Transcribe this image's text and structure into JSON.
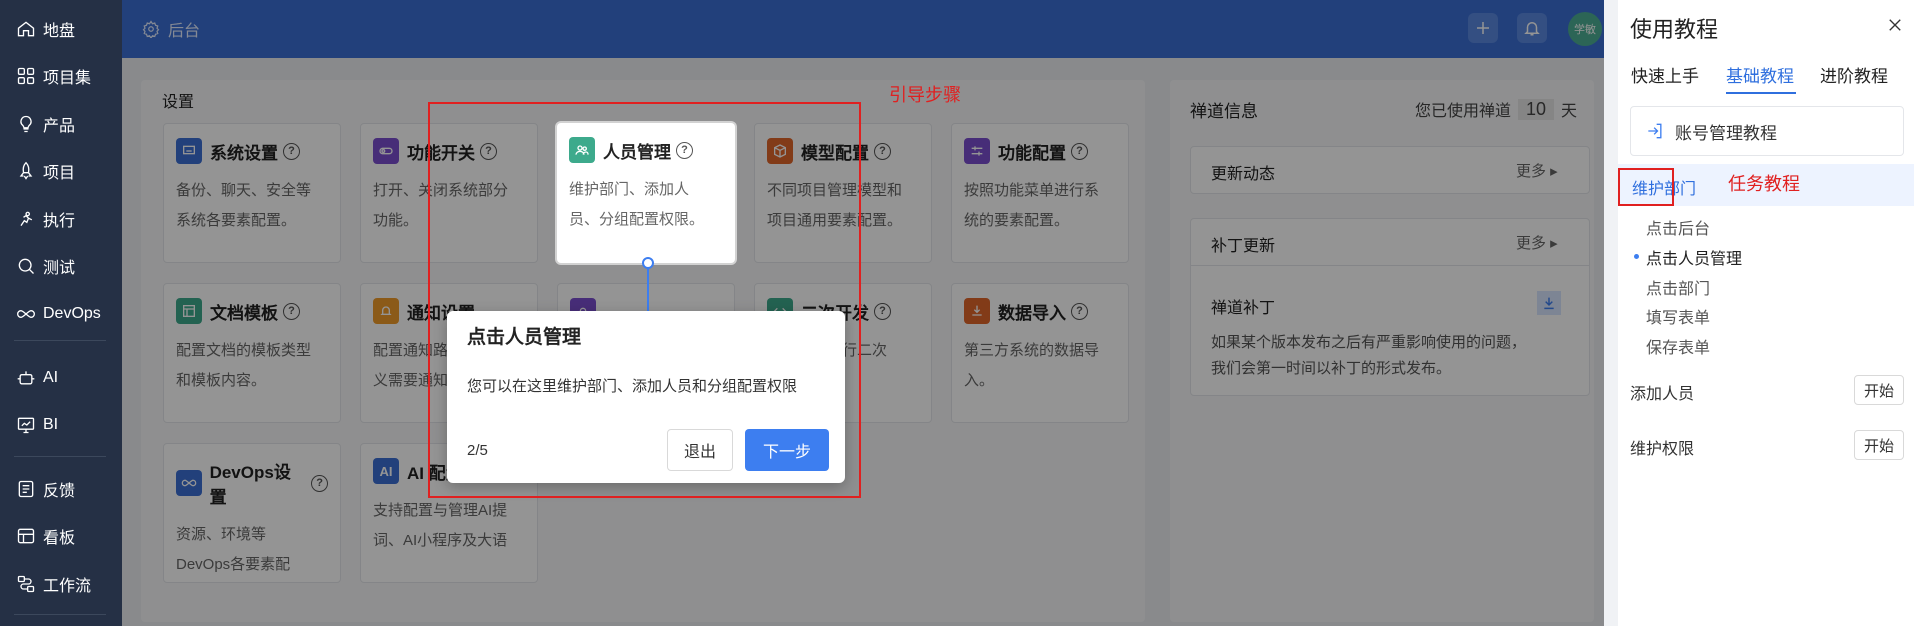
{
  "nav": {
    "items": [
      {
        "label": "地盘",
        "icon": "home-icon"
      },
      {
        "label": "项目集",
        "icon": "grid-icon"
      },
      {
        "label": "产品",
        "icon": "lightbulb-icon"
      },
      {
        "label": "项目",
        "icon": "rocket-icon"
      },
      {
        "label": "执行",
        "icon": "run-icon"
      },
      {
        "label": "测试",
        "icon": "search-bug-icon"
      },
      {
        "label": "DevOps",
        "icon": "infinity-icon"
      },
      {
        "label": "AI",
        "icon": "robot-icon"
      },
      {
        "label": "BI",
        "icon": "chart-icon"
      },
      {
        "label": "反馈",
        "icon": "feedback-icon"
      },
      {
        "label": "看板",
        "icon": "kanban-icon"
      },
      {
        "label": "工作流",
        "icon": "workflow-icon"
      }
    ]
  },
  "header": {
    "title": "后台",
    "avatar_text": "学敏"
  },
  "settings": {
    "title": "设置",
    "cards": [
      {
        "title": "系统设置",
        "desc1": "备份、聊天、安全等",
        "desc2": "系统各要素配置。",
        "color": "#3b6fd4"
      },
      {
        "title": "功能开关",
        "desc1": "打开、关闭系统部分",
        "desc2": "功能。",
        "color": "#7b4fcf"
      },
      {
        "title": "模型配置",
        "desc1": "不同项目管理模型和",
        "desc2": "项目通用要素配置。",
        "color": "#e0672a"
      },
      {
        "title": "功能配置",
        "desc1": "按照功能菜单进行系",
        "desc2": "统的要素配置。",
        "color": "#7b4fcf"
      },
      {
        "title": "文档模板",
        "desc1": "配置文档的模板类型",
        "desc2": "和模板内容。",
        "color": "#3daa8c"
      },
      {
        "title": "通知设置",
        "desc1": "配置通知路",
        "desc2": "义需要通知",
        "color": "#f09b2a"
      },
      {
        "title": "二次开发",
        "desc1": "进行二次",
        "desc2": "",
        "color": "#3daa8c"
      },
      {
        "title": "数据导入",
        "desc1": "第三方系统的数据导",
        "desc2": "入。",
        "color": "#e0672a"
      },
      {
        "title": "DevOps设置",
        "desc1": "资源、环境等",
        "desc2": "DevOps各要素配",
        "color": "#3b6fd4"
      },
      {
        "title": "AI 配置",
        "desc1": "支持配置与管理AI提",
        "desc2": "词、AI小程序及大语",
        "color": "#3b6fd4"
      }
    ],
    "highlight": {
      "title": "人员管理",
      "desc1": "维护部门、添加人",
      "desc2": "员、分组配置权限。",
      "color": "#3daa8c"
    }
  },
  "info": {
    "title": "禅道信息",
    "used_prefix": "您已使用禅道",
    "used_days": "10",
    "used_suffix": "天",
    "updates": {
      "title": "更新动态",
      "more": "更多"
    },
    "patches": {
      "title": "补丁更新",
      "more": "更多"
    },
    "patch_card": {
      "title": "禅道补丁",
      "line1": "如果某个版本发布之后有严重影响使用的问题，",
      "line2": "我们会第一时间以补丁的形式发布。"
    }
  },
  "popover": {
    "title": "点击人员管理",
    "body": "您可以在这里维护部门、添加人员和分组配置权限",
    "counter": "2/5",
    "exit": "退出",
    "next": "下一步"
  },
  "annotations": {
    "guide_steps": "引导步骤",
    "task_tutorial": "任务教程"
  },
  "drawer": {
    "title": "使用教程",
    "tabs": [
      "快速上手",
      "基础教程",
      "进阶教程"
    ],
    "active_tab": "基础教程",
    "account": "账号管理教程",
    "selected_task": "维护部门",
    "steps": [
      "点击后台",
      "点击人员管理",
      "点击部门",
      "填写表单",
      "保存表单"
    ],
    "current_step": "点击人员管理",
    "tasks": [
      {
        "label": "添加人员",
        "button": "开始"
      },
      {
        "label": "维护权限",
        "button": "开始"
      }
    ]
  }
}
